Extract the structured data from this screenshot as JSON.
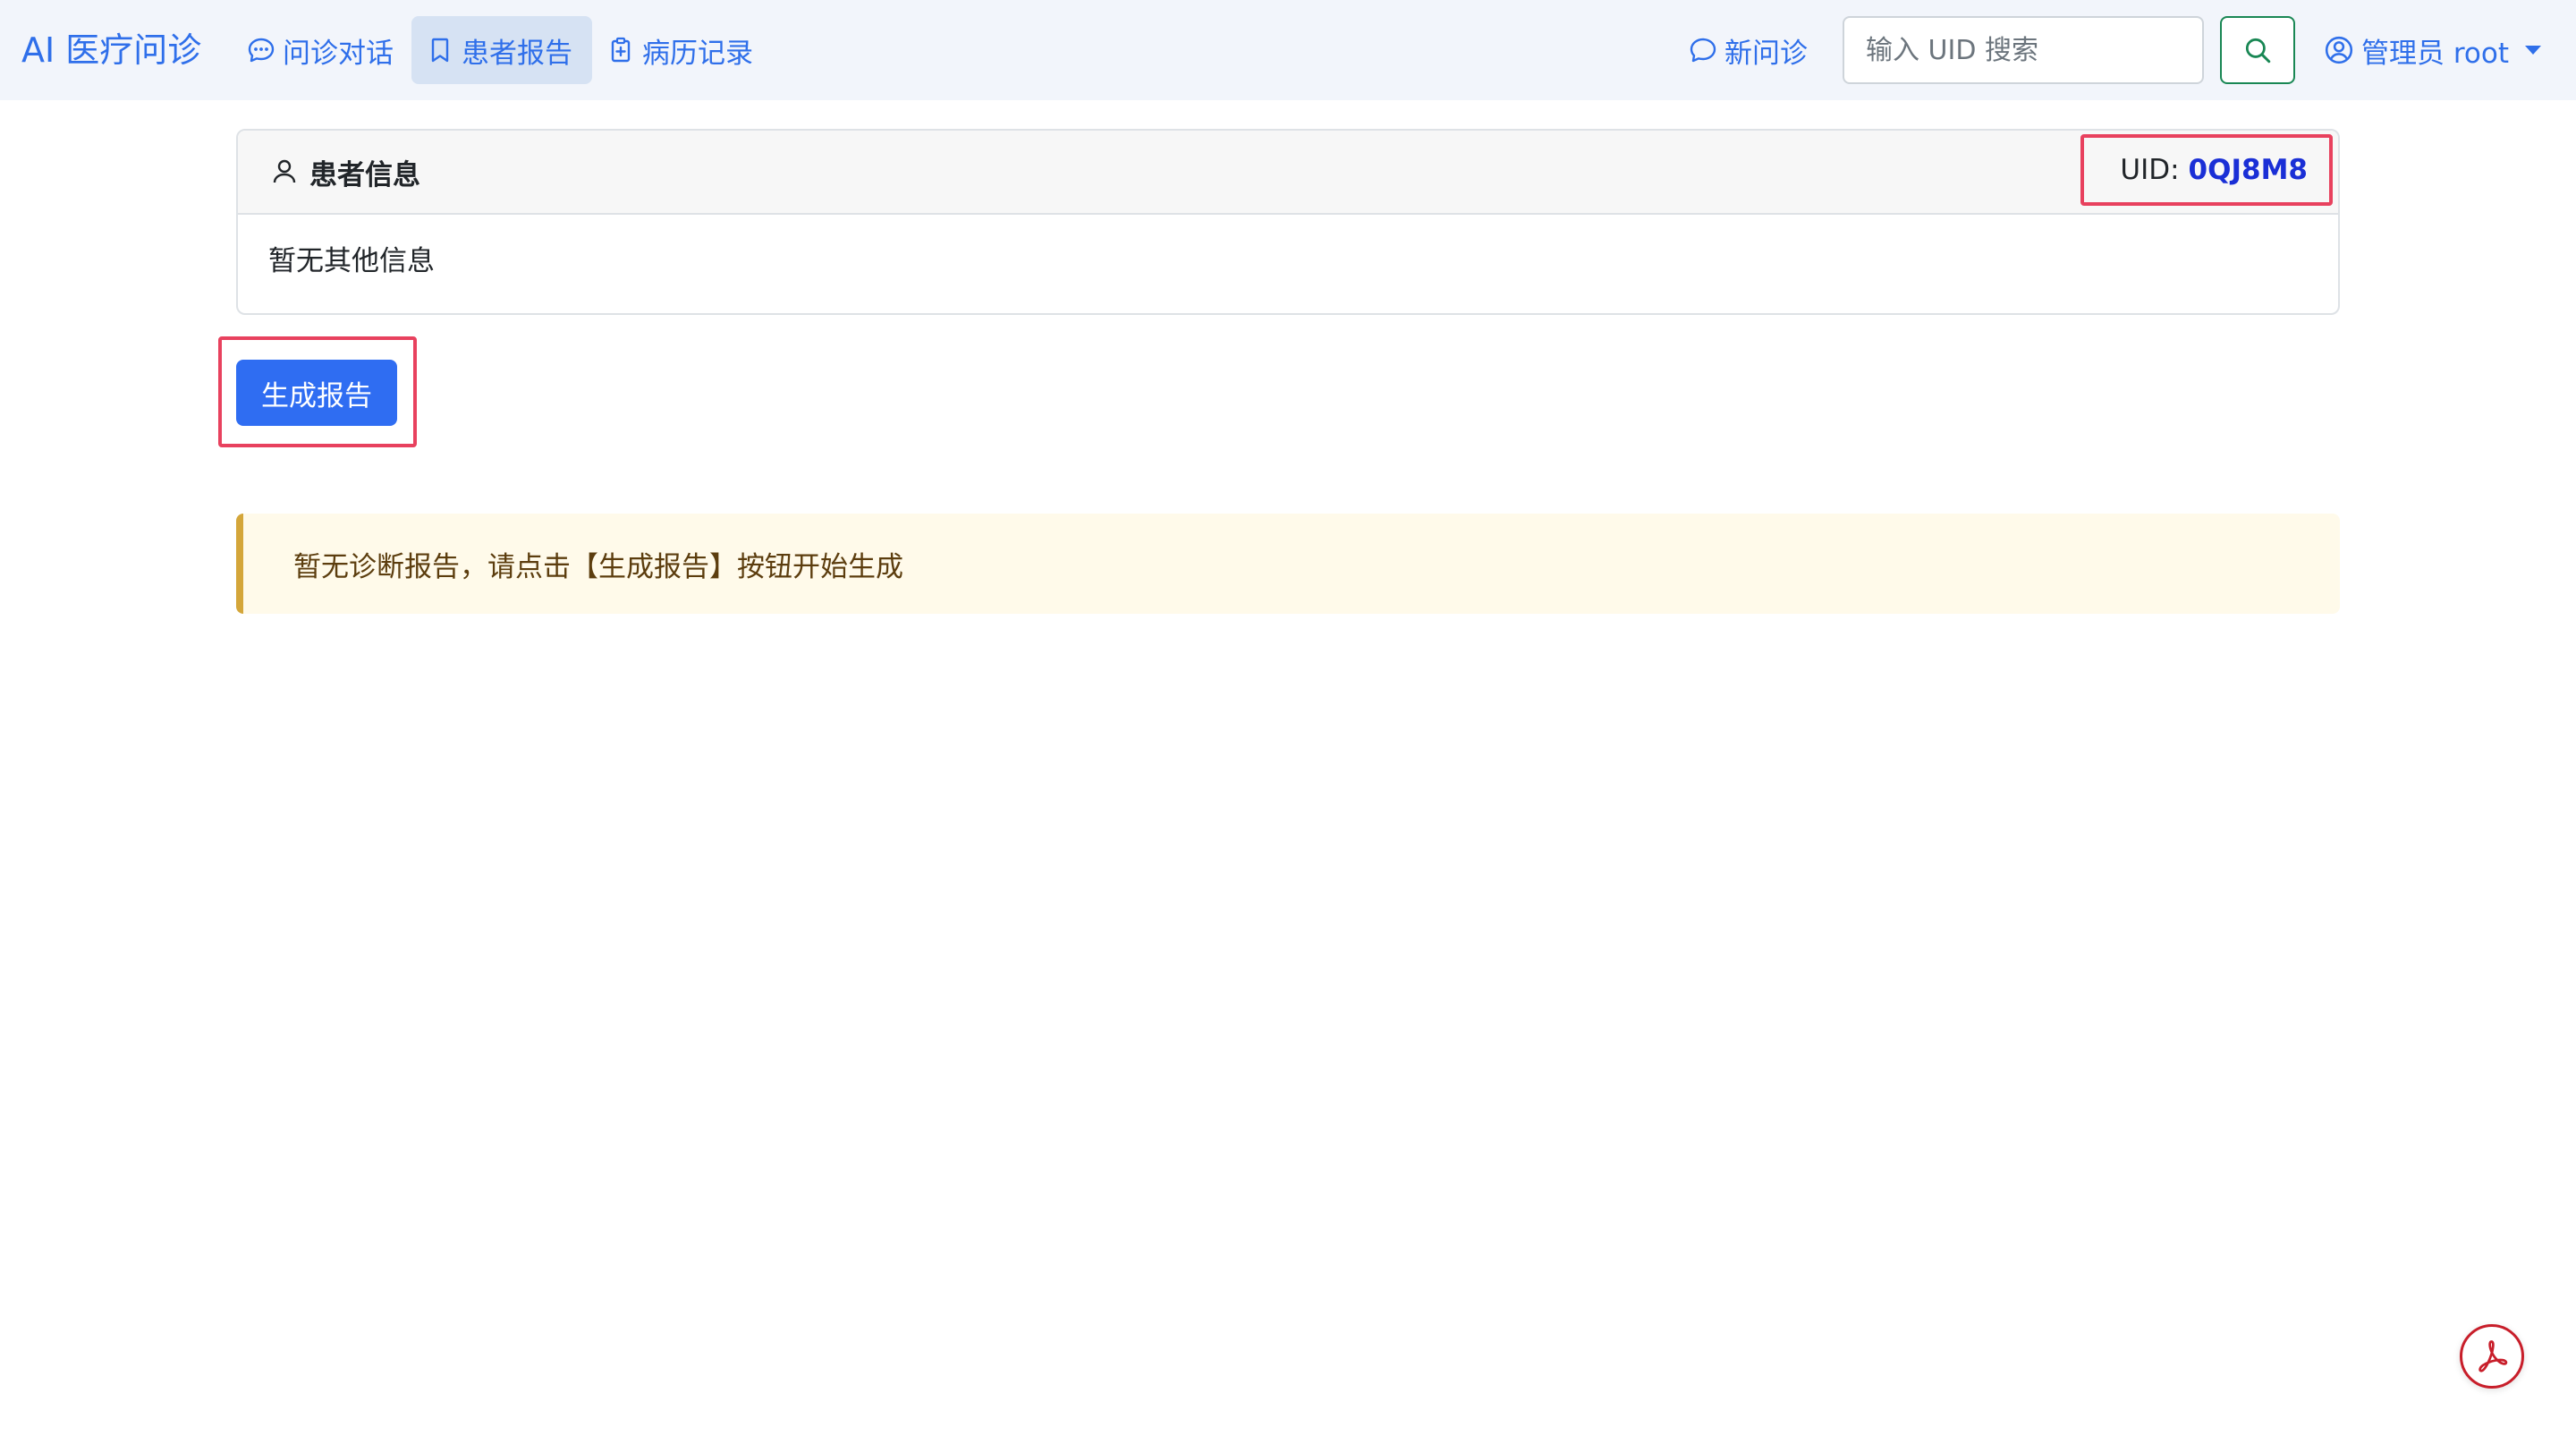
{
  "navbar": {
    "brand": "AI 医疗问诊",
    "links": [
      {
        "label": "问诊对话",
        "icon": "chat-dots-icon"
      },
      {
        "label": "患者报告",
        "icon": "bookmark-icon",
        "active": true
      },
      {
        "label": "病历记录",
        "icon": "clipboard-plus-icon"
      }
    ],
    "new_consult": {
      "label": "新问诊",
      "icon": "chat-bubble-icon"
    },
    "search": {
      "placeholder": "输入 UID 搜索",
      "value": "",
      "button_icon": "search-icon"
    },
    "user": {
      "label": "管理员 root",
      "icon": "user-circle-icon"
    }
  },
  "patient_card": {
    "title": "患者信息",
    "title_icon": "person-icon",
    "uid_label": "UID:",
    "uid_value": "0QJ8M8",
    "body_text": "暂无其他信息"
  },
  "actions": {
    "generate_label": "生成报告"
  },
  "alert": {
    "message": "暂无诊断报告，请点击【生成报告】按钮开始生成"
  },
  "floating": {
    "icon": "pdf-icon"
  },
  "colors": {
    "primary": "#2f6fea",
    "button_primary": "#2f6df2",
    "highlight_border": "#e8415e",
    "search_border": "#198754",
    "uid_value": "#1a2fd6",
    "alert_bg": "#fffaea",
    "alert_border": "#d4a63a",
    "alert_text": "#5c3d0e",
    "pdf": "#c81e2a"
  }
}
